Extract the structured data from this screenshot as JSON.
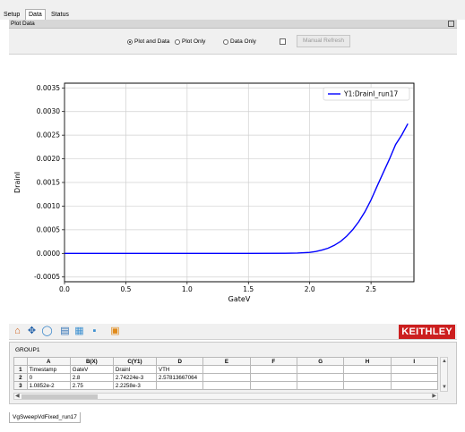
{
  "tabs": [
    "Setup",
    "Data",
    "Status"
  ],
  "active_tab": "Data",
  "panel_title": "Plot Data",
  "view_options": {
    "plot_and_data": "Plot and Data",
    "plot_only": "Plot Only",
    "data_only": "Data Only",
    "selected": "plot_and_data",
    "manual_refresh": "Manual Refresh"
  },
  "chart_data": {
    "type": "line",
    "xlabel": "GateV",
    "ylabel": "DrainI",
    "xlim": [
      0,
      2.85
    ],
    "ylim": [
      -0.0006,
      0.0036
    ],
    "x_ticks": [
      "0.0",
      "0.5",
      "1.0",
      "1.5",
      "2.0",
      "2.5"
    ],
    "y_ticks": [
      "-0.0005",
      "0.0000",
      "0.0005",
      "0.0010",
      "0.0015",
      "0.0020",
      "0.0025",
      "0.0030",
      "0.0035"
    ],
    "grid": true,
    "legend_position": "top-right",
    "series": [
      {
        "name": "Y1:DrainI_run17",
        "color": "#0000ff",
        "x": [
          0,
          0.5,
          1.0,
          1.5,
          1.8,
          1.9,
          2.0,
          2.05,
          2.1,
          2.15,
          2.2,
          2.25,
          2.3,
          2.35,
          2.4,
          2.45,
          2.5,
          2.55,
          2.6,
          2.65,
          2.7,
          2.75,
          2.8
        ],
        "y": [
          0,
          0,
          0,
          0,
          2e-06,
          7e-06,
          2e-05,
          4e-05,
          7e-05,
          0.00011,
          0.00017,
          0.00025,
          0.00036,
          0.0005,
          0.00067,
          0.00088,
          0.00113,
          0.00142,
          0.00171,
          0.00199,
          0.0023,
          0.0025,
          0.0027422
        ]
      }
    ]
  },
  "toolbar": {
    "icons": [
      "home-icon",
      "pan-icon",
      "zoom-icon",
      "save-icon",
      "subplot-icon",
      "axis-icon",
      "color-icon"
    ],
    "logo": "KEITHLEY"
  },
  "table": {
    "group": "GROUP1",
    "columns": [
      "",
      "A",
      "B(X)",
      "C(Y1)",
      "D",
      "E",
      "F",
      "G",
      "H",
      "I"
    ],
    "rows": [
      [
        "1",
        "Timestamp",
        "GateV",
        "DrainI",
        "VTH",
        "",
        "",
        "",
        "",
        ""
      ],
      [
        "2",
        "0",
        "2.8",
        "2.74224e-3",
        "2.57813667064",
        "",
        "",
        "",
        "",
        ""
      ],
      [
        "3",
        "1.0852e-2",
        "2.75",
        "2.2258e-3",
        "",
        "",
        "",
        "",
        "",
        ""
      ]
    ]
  },
  "sheet_tab": "VgSweepVdFixed_run17"
}
